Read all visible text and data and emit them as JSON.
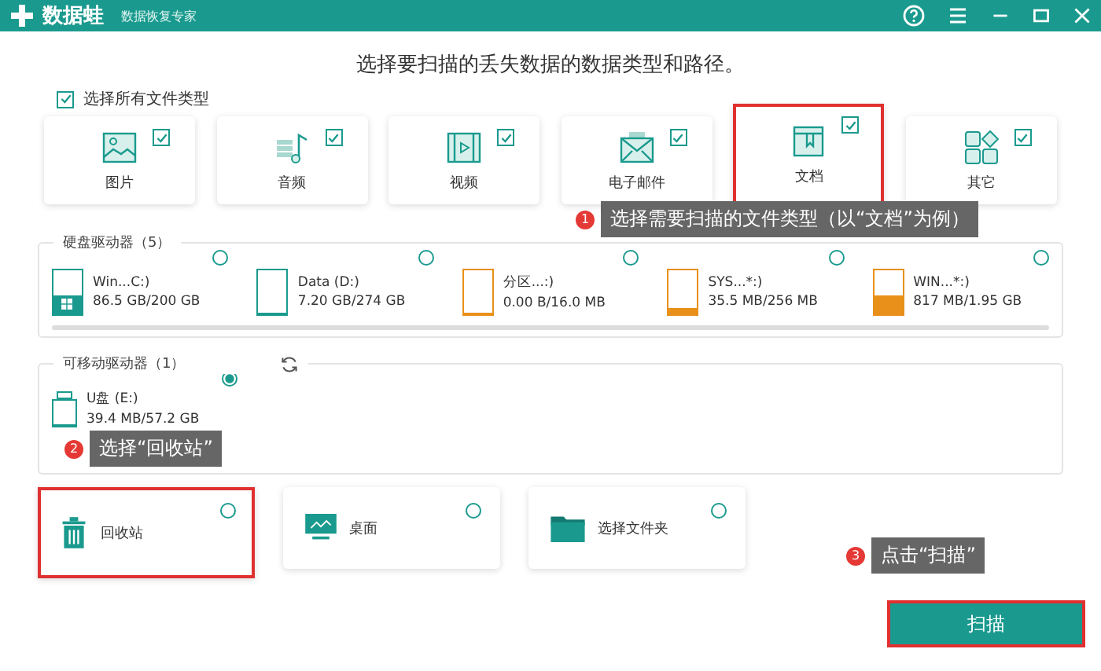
{
  "app": {
    "name": "数据蛙",
    "subtitle": "数据恢复专家"
  },
  "heading": "选择要扫描的丢失数据的数据类型和路径。",
  "select_all": {
    "label": "选择所有文件类型",
    "checked": true
  },
  "file_types": [
    {
      "kind": "image",
      "label": "图片",
      "checked": true,
      "highlighted": false
    },
    {
      "kind": "audio",
      "label": "音频",
      "checked": true,
      "highlighted": false
    },
    {
      "kind": "video",
      "label": "视频",
      "checked": true,
      "highlighted": false
    },
    {
      "kind": "email",
      "label": "电子邮件",
      "checked": true,
      "highlighted": false
    },
    {
      "kind": "document",
      "label": "文档",
      "checked": true,
      "highlighted": true
    },
    {
      "kind": "other",
      "label": "其它",
      "checked": true,
      "highlighted": false
    }
  ],
  "hard_drives": {
    "title": "硬盘驱动器（5）",
    "items": [
      {
        "name": "Win...C:)",
        "size": "86.5 GB/200 GB",
        "level": 0.43,
        "color": "#1a9a8e",
        "system": true,
        "selected": false
      },
      {
        "name": "Data (D:)",
        "size": "7.20 GB/274 GB",
        "level": 0.03,
        "color": "#1a9a8e",
        "system": false,
        "selected": false
      },
      {
        "name": "分区...:)",
        "size": "0.00  B/16.0 MB",
        "level": 0,
        "color": "#e8901a",
        "system": false,
        "selected": false
      },
      {
        "name": "SYS...*:)",
        "size": "35.5 MB/256 MB",
        "level": 0.14,
        "color": "#e8901a",
        "system": false,
        "selected": false
      },
      {
        "name": "WIN...*:)",
        "size": "817 MB/1.95 GB",
        "level": 0.42,
        "color": "#e8901a",
        "system": false,
        "selected": false
      }
    ]
  },
  "removable_drives": {
    "title": "可移动驱动器（1）",
    "items": [
      {
        "name": "U盘 (E:)",
        "size": "39.4 MB/57.2 GB",
        "level": 0.01,
        "selected": true
      }
    ]
  },
  "locations": [
    {
      "kind": "recycle_bin",
      "label": "回收站",
      "selected": false,
      "highlighted": true
    },
    {
      "kind": "desktop",
      "label": "桌面",
      "selected": false,
      "highlighted": false
    },
    {
      "kind": "folder",
      "label": "选择文件夹",
      "selected": false,
      "highlighted": false
    }
  ],
  "callouts": [
    {
      "number": "1",
      "text": "选择需要扫描的文件类型（以“文档”为例）"
    },
    {
      "number": "2",
      "text": "选择“回收站”"
    },
    {
      "number": "3",
      "text": "点击“扫描”"
    }
  ],
  "scan_button": {
    "label": "扫描",
    "highlighted": true
  }
}
